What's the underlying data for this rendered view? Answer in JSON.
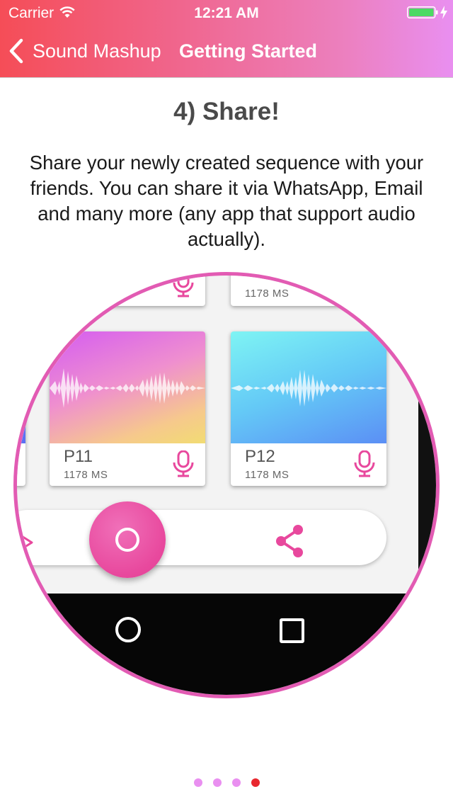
{
  "status_bar": {
    "carrier": "Carrier",
    "time": "12:21 AM"
  },
  "nav": {
    "back_label": "Sound Mashup",
    "title": "Getting Started"
  },
  "content": {
    "title": "4) Share!",
    "description": "Share your newly created sequence with your friends. You can share it via WhatsApp, Email and many more (any app that support audio actually)."
  },
  "preview": {
    "cards": [
      {
        "name": "",
        "duration": "1178 MS"
      },
      {
        "name": "P11",
        "duration": "1178 MS"
      },
      {
        "name": "P12",
        "duration": "1178 MS"
      }
    ],
    "controls": {
      "record_icon": "record-ring-icon",
      "share_icon": "share-icon"
    }
  },
  "page_indicator": {
    "count": 4,
    "active_index": 3,
    "inactive_color": "#e98ff0",
    "active_color": "#e8272f"
  },
  "colors": {
    "header_gradient_start": "#f54d57",
    "header_gradient_end": "#e98ff0",
    "accent_pink": "#e8489d",
    "battery_green": "#4cd964"
  }
}
